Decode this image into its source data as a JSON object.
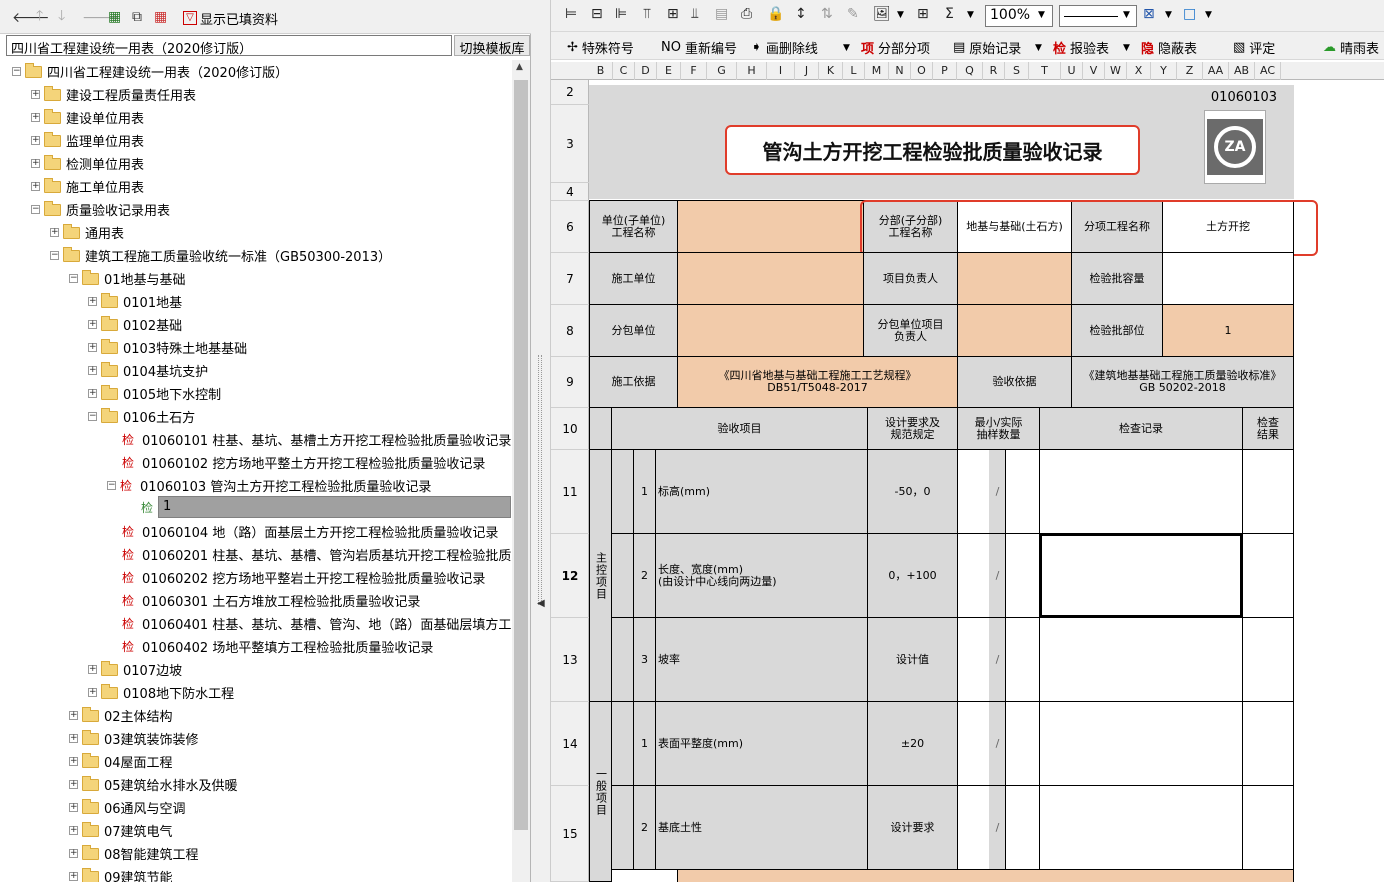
{
  "left_toolbar": {
    "show_filled_label": "显示已填资料"
  },
  "library": {
    "name": "四川省工程建设统一用表（2020修订版）",
    "switch_label": "切换模板库"
  },
  "tree": {
    "root": "四川省工程建设统一用表（2020修订版）",
    "items": [
      "建设工程质量责任用表",
      "建设单位用表",
      "监理单位用表",
      "检测单位用表",
      "施工单位用表",
      "质量验收记录用表",
      "通用表",
      "建筑工程施工质量验收统一标准（GB50300-2013）",
      "01地基与基础",
      "0101地基",
      "0102基础",
      "0103特殊土地基基础",
      "0104基坑支护",
      "0105地下水控制",
      "0106土石方"
    ],
    "check_prefix": "检",
    "forms": [
      "01060101 柱基、基坑、基槽土方开挖工程检验批质量验收记录",
      "01060102 挖方场地平整土方开挖工程检验批质量验收记录",
      "01060103 管沟土方开挖工程检验批质量验收记录",
      "01060104 地（路）面基层土方开挖工程检验批质量验收记录",
      "01060201 柱基、基坑、基槽、管沟岩质基坑开挖工程检验批质",
      "01060202 挖方场地平整岩土开挖工程检验批质量验收记录",
      "01060301 土石方堆放工程检验批质量验收记录",
      "01060401 柱基、基坑、基槽、管沟、地（路）面基础层填方工",
      "01060402 场地平整填方工程检验批质量验收记录"
    ],
    "selected_child": "1",
    "after": [
      "0107边坡",
      "0108地下防水工程",
      "02主体结构",
      "03建筑装饰装修",
      "04屋面工程",
      "05建筑给水排水及供暖",
      "06通风与空调",
      "07建筑电气",
      "08智能建筑工程",
      "09建筑节能"
    ]
  },
  "toolbar": {
    "zoom": "100%",
    "row2": [
      "特殊符号",
      "重新编号",
      "画删除线",
      "分部分项",
      "原始记录",
      "报验表",
      "隐蔽表",
      "评定",
      "晴雨表"
    ],
    "row2_glyphs": [
      "NO",
      "项",
      "检",
      "隐"
    ]
  },
  "columns": [
    "B",
    "C",
    "D",
    "E",
    "F",
    "G",
    "H",
    "I",
    "J",
    "K",
    "L",
    "M",
    "N",
    "O",
    "P",
    "Q",
    "R",
    "S",
    "T",
    "U",
    "V",
    "W",
    "X",
    "Y",
    "Z",
    "AA",
    "AB",
    "AC"
  ],
  "rows": [
    "2",
    "3",
    "4",
    "6",
    "7",
    "8",
    "9",
    "10",
    "11",
    "12",
    "13",
    "14",
    "15"
  ],
  "form": {
    "code": "01060103",
    "title": "管沟土方开挖工程检验批质量验收记录",
    "logo_text": "ZA",
    "unit_label": "单位(子单位)\n工程名称",
    "subdiv_label": "分部(子分部)\n工程名称",
    "subdiv_value": "地基与基础(土石方)",
    "item_label": "分项工程名称",
    "item_value": "土方开挖",
    "contractor_label": "施工单位",
    "pm_label": "项目负责人",
    "capacity_label": "检验批容量",
    "sub_label": "分包单位",
    "sub_pm_label": "分包单位项目\n负责人",
    "part_label": "检验批部位",
    "part_value": "1",
    "basis_label": "施工依据",
    "basis_value": "《四川省地基与基础工程施工工艺规程》\nDB51/T5048-2017",
    "accept_label": "验收依据",
    "accept_value": "《建筑地基基础工程施工质量验收标准》\nGB 50202-2018",
    "h_item": "验收项目",
    "h_req": "设计要求及\n规范规定",
    "h_sample": "最小/实际\n抽样数量",
    "h_record": "检查记录",
    "h_result": "检查\n结果",
    "main_group": "主控项目",
    "general_group": "一般项目",
    "slash": "/",
    "items": [
      {
        "no": "1",
        "name": "标高(mm)",
        "req": "-50，0"
      },
      {
        "no": "2",
        "name": "长度、宽度(mm)\n(由设计中心线向两边量)",
        "req": "0，+100"
      },
      {
        "no": "3",
        "name": "坡率",
        "req": "设计值"
      },
      {
        "no": "1",
        "name": "表面平整度(mm)",
        "req": "±20"
      },
      {
        "no": "2",
        "name": "基底土性",
        "req": "设计要求"
      }
    ]
  },
  "colors": {
    "gray": "#d9d9d9",
    "peach": "#f2cbaa",
    "highlight_red": "#e03c2a"
  }
}
